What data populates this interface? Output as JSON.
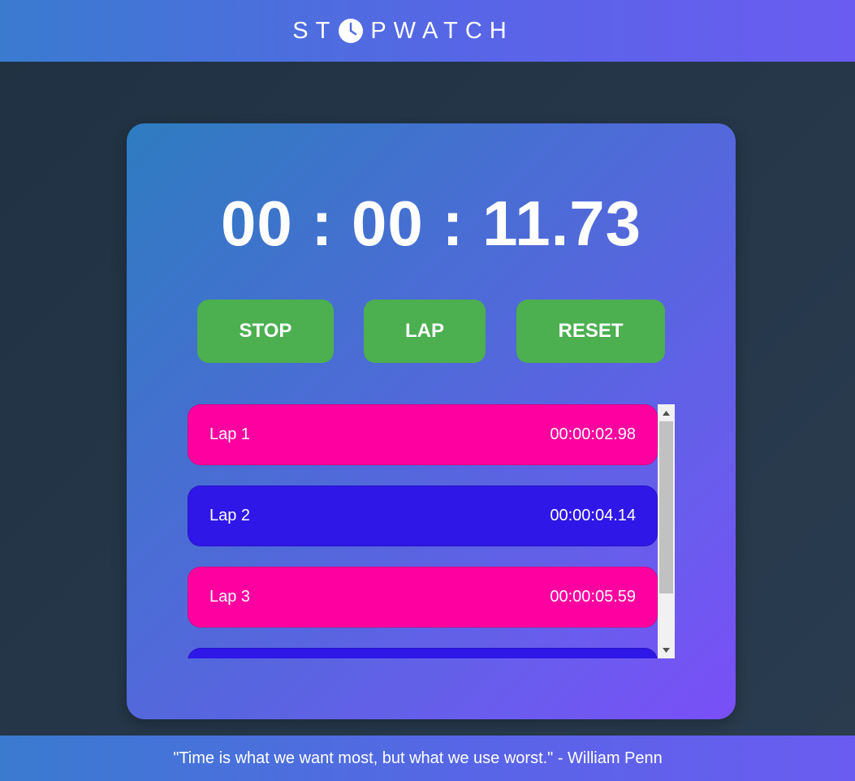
{
  "header": {
    "title_before": "ST",
    "title_icon": "clock-icon",
    "title_after": "PWATCH"
  },
  "timer": {
    "display": "00 : 00 : 11.73"
  },
  "controls": {
    "stop_label": "STOP",
    "lap_label": "LAP",
    "reset_label": "RESET"
  },
  "laps": [
    {
      "label": "Lap 1",
      "time": "00:00:02.98",
      "color": "#ff00a0"
    },
    {
      "label": "Lap 2",
      "time": "00:00:04.14",
      "color": "#2f17e8"
    },
    {
      "label": "Lap 3",
      "time": "00:00:05.59",
      "color": "#ff00a0"
    },
    {
      "label": "",
      "time": "",
      "color": "#2f17e8"
    }
  ],
  "footer": {
    "quote": "\"Time is what we want most, but what we use worst.\" - William Penn"
  },
  "colors": {
    "button_green": "#4caf50",
    "lap_pink": "#ff00a0",
    "lap_blue": "#2f17e8"
  }
}
